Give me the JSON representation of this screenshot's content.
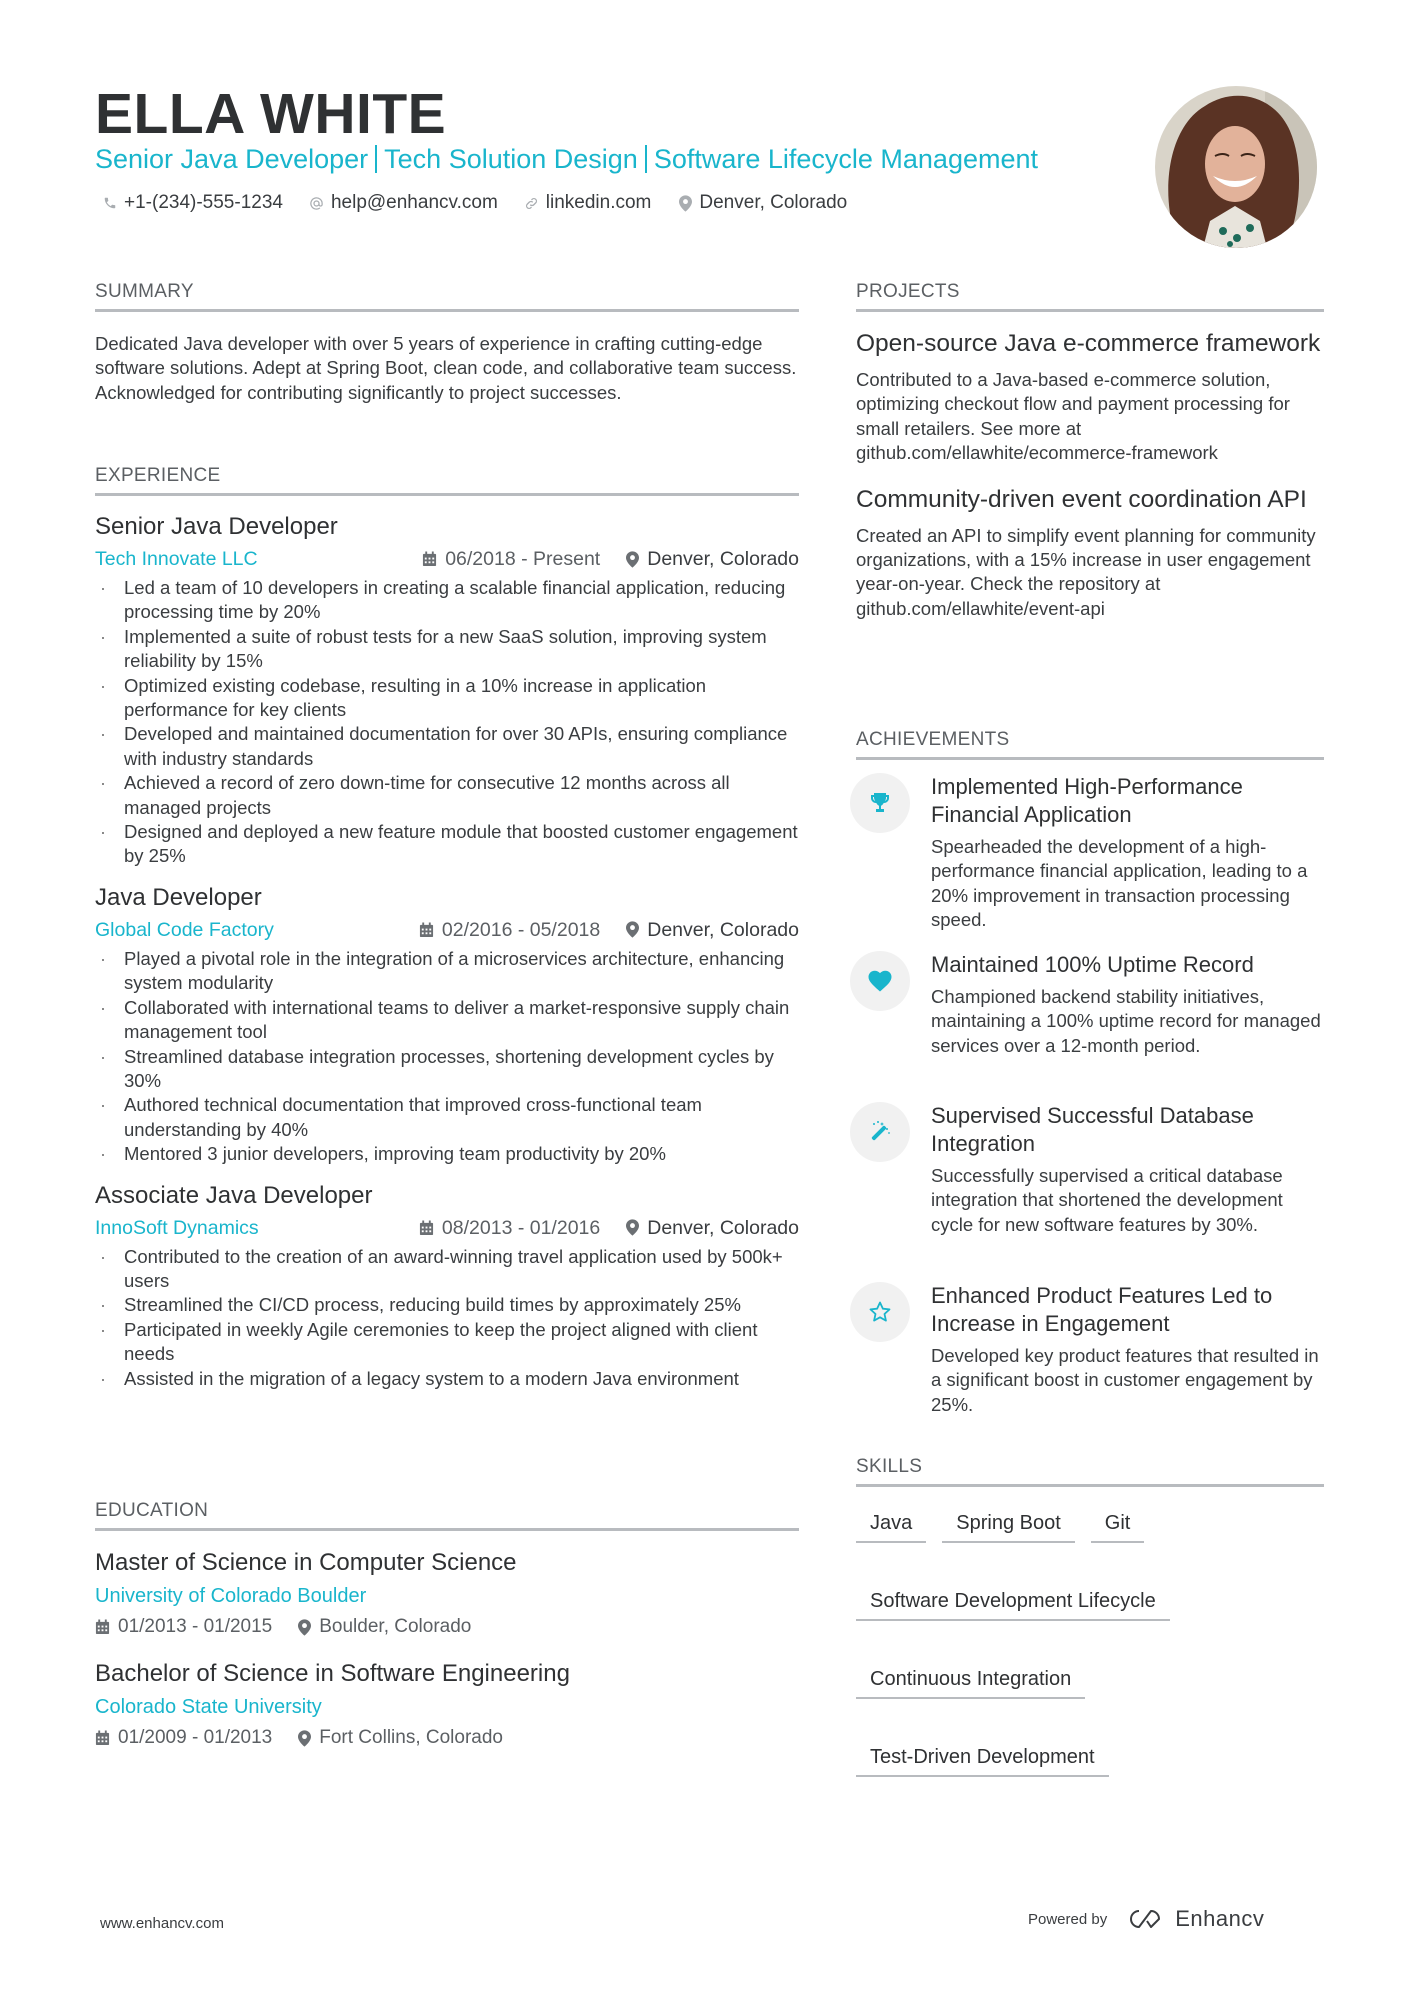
{
  "header": {
    "name": "ELLA WHITE",
    "headline_parts": [
      "Senior Java Developer",
      "Tech Solution Design",
      "Software Lifecycle Management"
    ],
    "contacts": [
      {
        "icon": "phone-icon",
        "text": "+1-(234)-555-1234"
      },
      {
        "icon": "at-icon",
        "text": "help@enhancv.com"
      },
      {
        "icon": "link-icon",
        "text": "linkedin.com"
      },
      {
        "icon": "location-pin-icon",
        "text": "Denver, Colorado"
      }
    ],
    "photo_alt": "Profile photo of Ella White"
  },
  "summary": {
    "title": "SUMMARY",
    "text": "Dedicated Java developer with over 5 years of experience in crafting cutting-edge software solutions. Adept at Spring Boot, clean code, and collaborative team success. Acknowledged for contributing significantly to project successes."
  },
  "experience": {
    "title": "EXPERIENCE",
    "jobs": [
      {
        "title": "Senior Java Developer",
        "company": "Tech Innovate LLC",
        "dates": "06/2018 - Present",
        "location": "Denver, Colorado",
        "bullets": [
          "Led a team of 10 developers in creating a scalable financial application, reducing processing time by 20%",
          "Implemented a suite of robust tests for a new SaaS solution, improving system reliability by 15%",
          "Optimized existing codebase, resulting in a 10% increase in application performance for key clients",
          "Developed and maintained documentation for over 30 APIs, ensuring compliance with industry standards",
          "Achieved a record of zero down-time for consecutive 12 months across all managed projects",
          "Designed and deployed a new feature module that boosted customer engagement by 25%"
        ]
      },
      {
        "title": "Java Developer",
        "company": "Global Code Factory",
        "dates": "02/2016 - 05/2018",
        "location": "Denver, Colorado",
        "bullets": [
          "Played a pivotal role in the integration of a microservices architecture, enhancing system modularity",
          "Collaborated with international teams to deliver a market-responsive supply chain management tool",
          "Streamlined database integration processes, shortening development cycles by 30%",
          "Authored technical documentation that improved cross-functional team understanding by 40%",
          "Mentored 3 junior developers, improving team productivity by 20%"
        ]
      },
      {
        "title": "Associate Java Developer",
        "company": "InnoSoft Dynamics",
        "dates": "08/2013 - 01/2016",
        "location": "Denver, Colorado",
        "bullets": [
          "Contributed to the creation of an award-winning travel application used by 500k+ users",
          "Streamlined the CI/CD process, reducing build times by approximately 25%",
          "Participated in weekly Agile ceremonies to keep the project aligned with client needs",
          "Assisted in the migration of a legacy system to a modern Java environment"
        ]
      }
    ]
  },
  "education": {
    "title": "EDUCATION",
    "items": [
      {
        "degree": "Master of Science in Computer Science",
        "school": "University of Colorado Boulder",
        "dates": "01/2013 - 01/2015",
        "location": "Boulder, Colorado"
      },
      {
        "degree": "Bachelor of Science in Software Engineering",
        "school": "Colorado State University",
        "dates": "01/2009 - 01/2013",
        "location": "Fort Collins, Colorado"
      }
    ]
  },
  "projects": {
    "title": "PROJECTS",
    "items": [
      {
        "title": "Open-source Java e-commerce framework",
        "description": "Contributed to a Java-based e-commerce solution, optimizing checkout flow and payment processing for small retailers. See more at github.com/ellawhite/ecommerce-framework"
      },
      {
        "title": "Community-driven event coordination API",
        "description": "Created an API to simplify event planning for community organizations, with a 15% increase in user engagement year-on-year. Check the repository at github.com/ellawhite/event-api"
      }
    ]
  },
  "achievements": {
    "title": "ACHIEVEMENTS",
    "items": [
      {
        "icon": "trophy-icon",
        "title": "Implemented High-Performance Financial Application",
        "description": "Spearheaded the development of a high-performance financial application, leading to a 20% improvement in transaction processing speed."
      },
      {
        "icon": "heart-icon",
        "title": "Maintained 100% Uptime Record",
        "description": "Championed backend stability initiatives, maintaining a 100% uptime record for managed services over a 12-month period."
      },
      {
        "icon": "magic-wand-icon",
        "title": "Supervised Successful Database Integration",
        "description": "Successfully supervised a critical database integration that shortened the development cycle for new software features by 30%."
      },
      {
        "icon": "star-icon",
        "title": "Enhanced Product Features Led to Increase in Engagement",
        "description": "Developed key product features that resulted in a significant boost in customer engagement by 25%."
      }
    ]
  },
  "skills": {
    "title": "SKILLS",
    "items": [
      "Java",
      "Spring Boot",
      "Git",
      "Software Development Lifecycle",
      "Continuous Integration",
      "Test-Driven Development"
    ]
  },
  "footer": {
    "website": "www.enhancv.com",
    "powered_by": "Powered by",
    "brand": "Enhancv"
  },
  "colors": {
    "accent": "#19b5cc",
    "text": "#3a3d40",
    "rule": "#b8bbbf",
    "icon_bg": "#f1f1f1"
  }
}
